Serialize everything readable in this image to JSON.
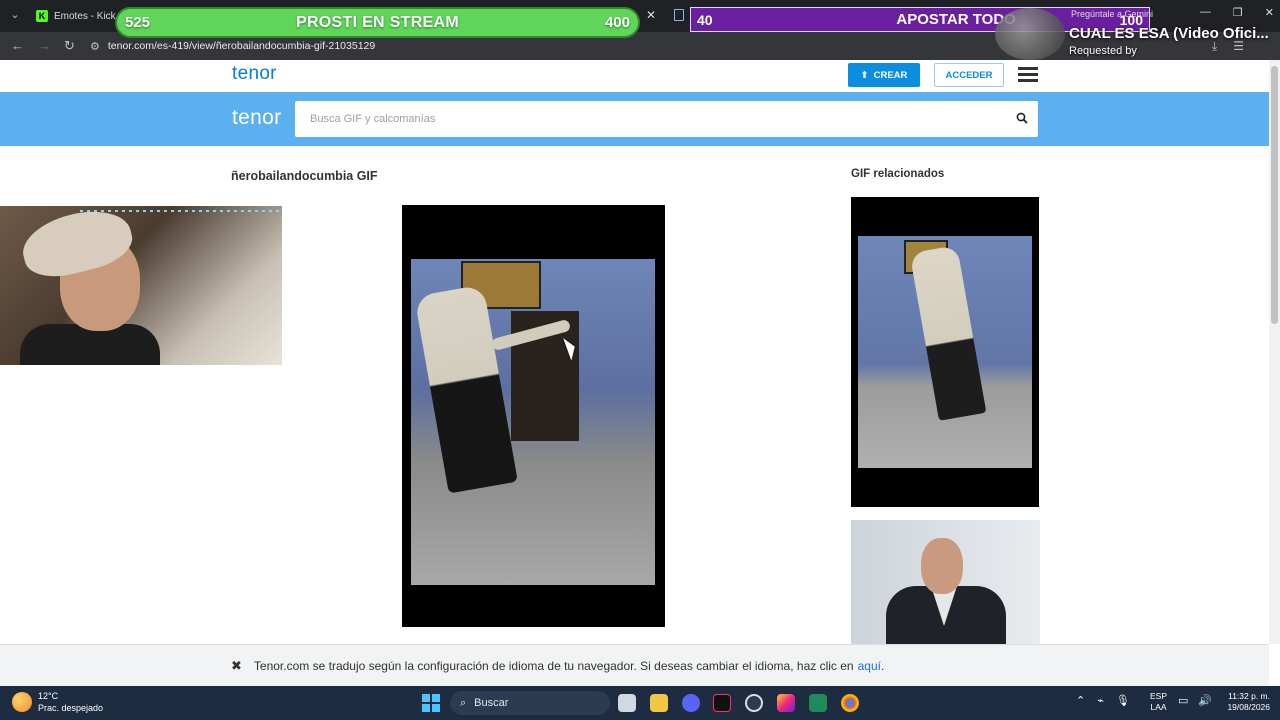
{
  "browser": {
    "tabs": [
      {
        "label": "Emotes - Kick Da"
      },
      {
        "label": ""
      }
    ],
    "url": "tenor.com/es-419/view/ñerobailandocumbia-gif-21035129"
  },
  "overlay": {
    "bar_left_value": "525",
    "bar_title": "PROSTI EN STREAM",
    "bar_right_value": "400",
    "bet_value": "40",
    "bet_title": "APOSTAR TODO",
    "bet_end_value": "100",
    "music_small": "Pregúntale a Gemini",
    "music_title": "CUAL ES ESA (Video Ofici...",
    "requested_by": "Requested by"
  },
  "tenor": {
    "logo": "tenor",
    "create_label": "CREAR",
    "login_label": "ACCEDER",
    "search_placeholder": "Busca GIF y calcomanías",
    "gif_title": "ñerobailandocumbia GIF",
    "related_title": "GIF relacionados"
  },
  "translate_bar": {
    "message": "Tenor.com se tradujo según la configuración de idioma de tu navegador. Si deseas cambiar el idioma, haz clic en",
    "link": "aquí",
    "end": "."
  },
  "taskbar": {
    "temperature": "12°C",
    "weather": "Prac. despejado",
    "search_label": "Buscar",
    "lang_1": "ESP",
    "lang_2": "LAA",
    "time": "11:32 p. m.",
    "date": "19/08/2026"
  }
}
